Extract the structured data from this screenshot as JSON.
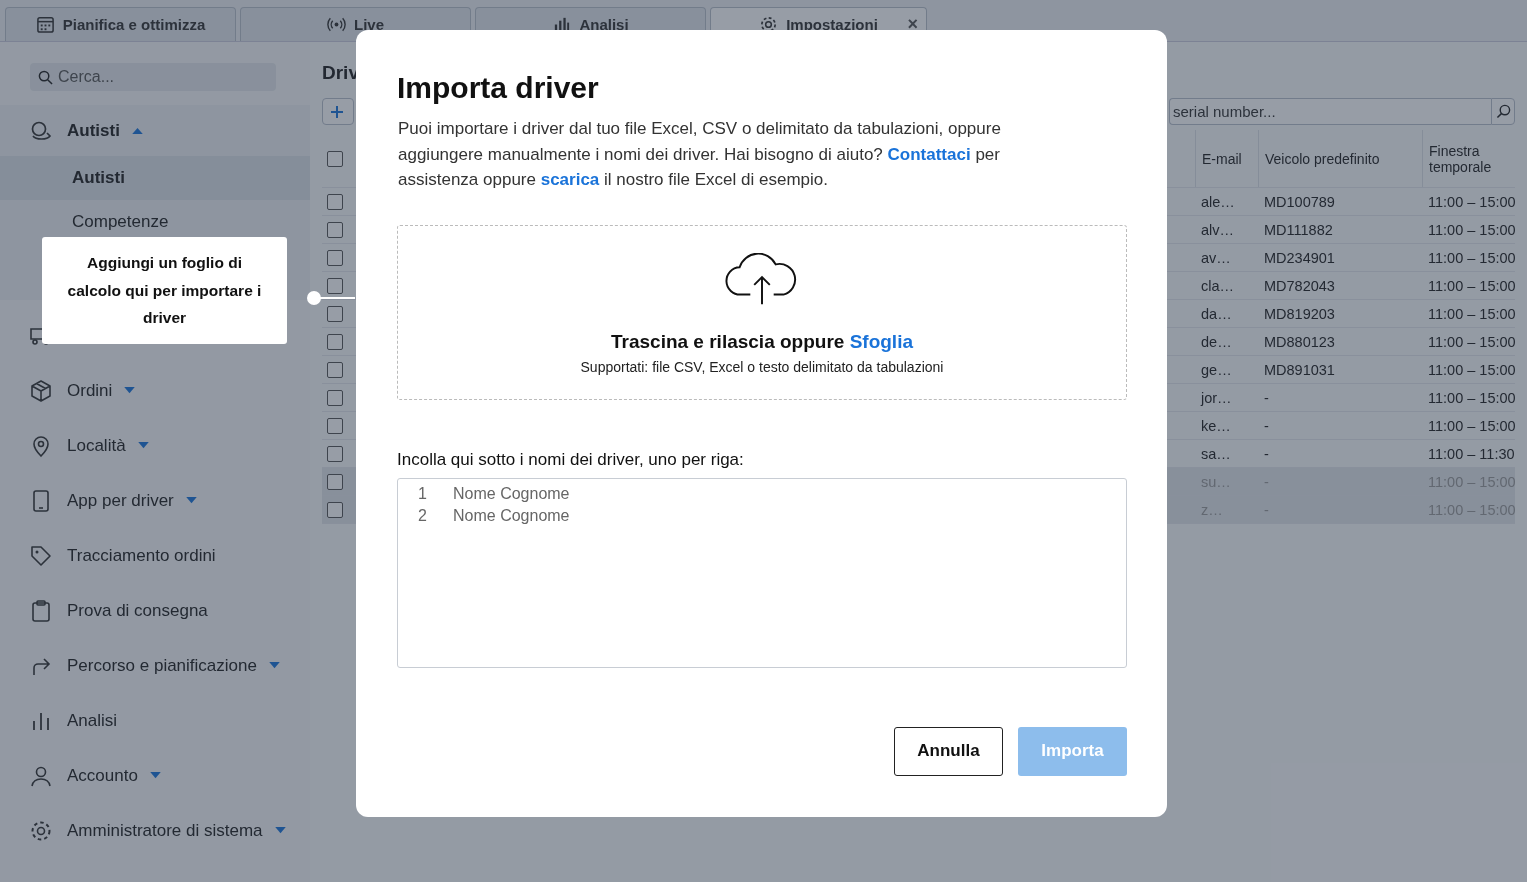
{
  "tabs": [
    {
      "label": "Pianifica e ottimizza",
      "selected": false
    },
    {
      "label": "Live",
      "selected": false
    },
    {
      "label": "Analisi",
      "selected": false
    },
    {
      "label": "Impostazioni",
      "selected": true,
      "close": "×"
    }
  ],
  "sidebar": {
    "search": {
      "placeholder": "Cerca..."
    },
    "items": [
      {
        "label": "Autisti",
        "expanded": true,
        "children": [
          {
            "label": "Autisti",
            "selected": true
          },
          {
            "label": "Competenze",
            "selected": false
          }
        ]
      },
      {
        "kind": "covered"
      },
      {
        "label": "Ordini",
        "expanded": false
      },
      {
        "label": "Località",
        "expanded": false
      },
      {
        "label": "App per driver",
        "expanded": false
      },
      {
        "label": "Tracciamento ordini"
      },
      {
        "label": "Prova di consegna"
      },
      {
        "label": "Percorso e pianificazione",
        "expanded": false
      },
      {
        "label": "Analisi"
      },
      {
        "label": "Accounto",
        "expanded": false
      },
      {
        "label": "Amministratore di sistema",
        "expanded": false
      }
    ]
  },
  "main": {
    "title": "Driv",
    "search": {
      "placeholder": "serial number..."
    },
    "table": {
      "columns": [
        "E-mail",
        "Veicolo predefinito",
        "Finestra temporale"
      ],
      "header_checked": false,
      "rows": [
        {
          "email": "ale…",
          "vehicle": "MD100789",
          "window": "11:00 – 15:00",
          "checked": false,
          "disabled": false
        },
        {
          "email": "alv…",
          "vehicle": "MD111882",
          "window": "11:00 – 15:00",
          "checked": false,
          "disabled": false
        },
        {
          "email": "av…",
          "vehicle": "MD234901",
          "window": "11:00 – 15:00",
          "checked": false,
          "disabled": false
        },
        {
          "email": "cla…",
          "vehicle": "MD782043",
          "window": "11:00 – 15:00",
          "checked": false,
          "disabled": false
        },
        {
          "email": "da…",
          "vehicle": "MD819203",
          "window": "11:00 – 15:00",
          "checked": false,
          "disabled": false
        },
        {
          "email": "de…",
          "vehicle": "MD880123",
          "window": "11:00 – 15:00",
          "checked": false,
          "disabled": false
        },
        {
          "email": "ge…",
          "vehicle": "MD891031",
          "window": "11:00 – 15:00",
          "checked": false,
          "disabled": false
        },
        {
          "email": "jor…",
          "vehicle": "-",
          "window": "11:00 – 15:00",
          "checked": false,
          "disabled": false
        },
        {
          "email": "ke…",
          "vehicle": "-",
          "window": "11:00 – 15:00",
          "checked": false,
          "disabled": false
        },
        {
          "email": "sa…",
          "vehicle": "-",
          "window": "11:00 – 11:30",
          "checked": false,
          "disabled": false
        },
        {
          "email": "su…",
          "vehicle": "-",
          "window": "11:00 – 15:00",
          "checked": false,
          "disabled": true
        },
        {
          "email": "z…",
          "vehicle": "-",
          "window": "11:00 – 15:00",
          "checked": false,
          "disabled": true
        }
      ]
    }
  },
  "callout": {
    "text": "Aggiungi un foglio di calcolo qui per importare i driver"
  },
  "dialog": {
    "title": "Importa driver",
    "intro": [
      {
        "kind": "text",
        "text": "Puoi importare i driver dal tuo file Excel, CSV o delimitato da tabulazioni, oppure aggiungere manualmente i nomi dei driver. Hai bisogno di aiuto? "
      },
      {
        "kind": "link",
        "text": "Contattaci"
      },
      {
        "kind": "text",
        "text": " per assistenza oppure "
      },
      {
        "kind": "link",
        "text": "scarica"
      },
      {
        "kind": "text",
        "text": " il nostro file Excel di esempio."
      }
    ],
    "dropzone": {
      "text": "Trascina e rilascia oppure",
      "link": "Sfoglia",
      "hint": "Supportati: file CSV, Excel o testo delimitato da tabulazioni"
    },
    "paste_label": "Incolla qui sotto i nomi dei driver, uno per riga:",
    "paste_field": {
      "lines": [
        {
          "number": "1",
          "placeholder": "Nome Cognome"
        },
        {
          "number": "2",
          "placeholder": "Nome Cognome"
        }
      ]
    },
    "buttons": [
      {
        "label": "Annulla",
        "kind": "secondary",
        "disabled": false
      },
      {
        "label": "Importa",
        "kind": "primary",
        "disabled": true
      }
    ]
  }
}
